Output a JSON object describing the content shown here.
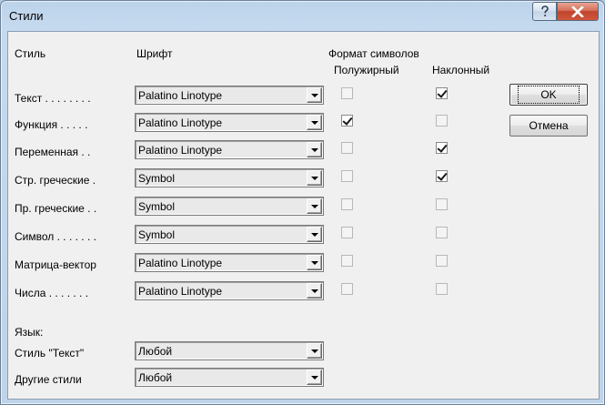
{
  "window": {
    "title": "Стили"
  },
  "headers": {
    "style": "Стиль",
    "font": "Шрифт",
    "format": "Формат символов",
    "bold": "Полужирный",
    "italic": "Наклонный"
  },
  "rows": [
    {
      "label": "Текст . . . . . . . .",
      "font": "Palatino Linotype",
      "bold": false,
      "italic": true
    },
    {
      "label": "Функция . . . . .",
      "font": "Palatino Linotype",
      "bold": true,
      "italic": false
    },
    {
      "label": "Переменная . .",
      "font": "Palatino Linotype",
      "bold": false,
      "italic": true
    },
    {
      "label": "Стр. греческие .",
      "font": "Symbol",
      "bold": false,
      "italic": true
    },
    {
      "label": "Пр. греческие . .",
      "font": "Symbol",
      "bold": false,
      "italic": false
    },
    {
      "label": "Символ . . . . . . .",
      "font": "Symbol",
      "bold": false,
      "italic": false
    },
    {
      "label": "Матрица-вектор",
      "font": "Palatino Linotype",
      "bold": false,
      "italic": false
    },
    {
      "label": "Числа . . . . . . .",
      "font": "Palatino Linotype",
      "bold": false,
      "italic": false
    }
  ],
  "language": {
    "title": "Язык:",
    "text_style_label": "Стиль \"Текст\"",
    "text_style_value": "Любой",
    "other_label": "Другие стили",
    "other_value": "Любой"
  },
  "buttons": {
    "ok": "OK",
    "cancel": "Отмена"
  },
  "icons": {
    "help": "question-mark-icon",
    "close": "close-x-icon"
  },
  "colors": {
    "close_button": "#c7472e",
    "dialog_bg": "#f0f0f0",
    "frame": "#bfd3e9"
  }
}
